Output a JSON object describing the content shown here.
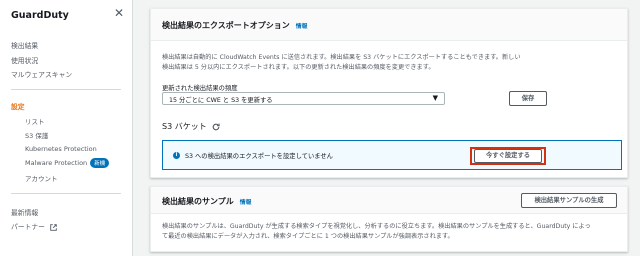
{
  "sidebar": {
    "title": "GuardDuty",
    "close_glyph": "✕",
    "items": [
      {
        "label": "検出結果"
      },
      {
        "label": "使用状況"
      },
      {
        "label": "マルウェアスキャン"
      }
    ],
    "settings_section": "設定",
    "settings_items": [
      {
        "label": "リスト"
      },
      {
        "label": "S3 保護"
      },
      {
        "label": "Kubernetes Protection"
      },
      {
        "label": "Malware Protection",
        "badge": "新機"
      },
      {
        "label": "アカウント"
      }
    ],
    "bottom_items": [
      {
        "label": "最新情報"
      },
      {
        "label": "パートナー"
      }
    ]
  },
  "export_panel": {
    "title": "検出結果のエクスポートオプション",
    "info": "情報",
    "description_lines": [
      "検出結果は自動的に CloudWatch Events に送信されます。検出結果を S3 バケットにエクスポートすることもできます。新しい",
      "検出結果は 5 分以内にエクスポートされます。以下の更新された検出結果の頻度を変更できます。"
    ],
    "frequency_label": "更新された検出結果の頻度",
    "frequency_value": "15 分ごとに CWE と S3 を更新する",
    "save_button": "保存",
    "s3_title": "S3 バケット",
    "alert_text": "S3 への検出結果のエクスポートを設定していません",
    "configure_button": "今すぐ設定する"
  },
  "sample_panel": {
    "title": "検出結果のサンプル",
    "info": "情報",
    "generate_button": "検出結果サンプルの生成",
    "description_lines": [
      "検出結果のサンプルは、GuardDuty が生成する検索タイプを視覚化し、分析するのに役立ちます。検出結果のサンプルを生成すると、GuardDuty によっ",
      "て最近の検出結果にデータが入力され、検索タイプごとに 1 つの検出結果サンプルが強調表示されます。"
    ]
  },
  "colors": {
    "accent_orange": "#ec7211",
    "link_blue": "#0073bb",
    "highlight_red": "#d13212"
  }
}
